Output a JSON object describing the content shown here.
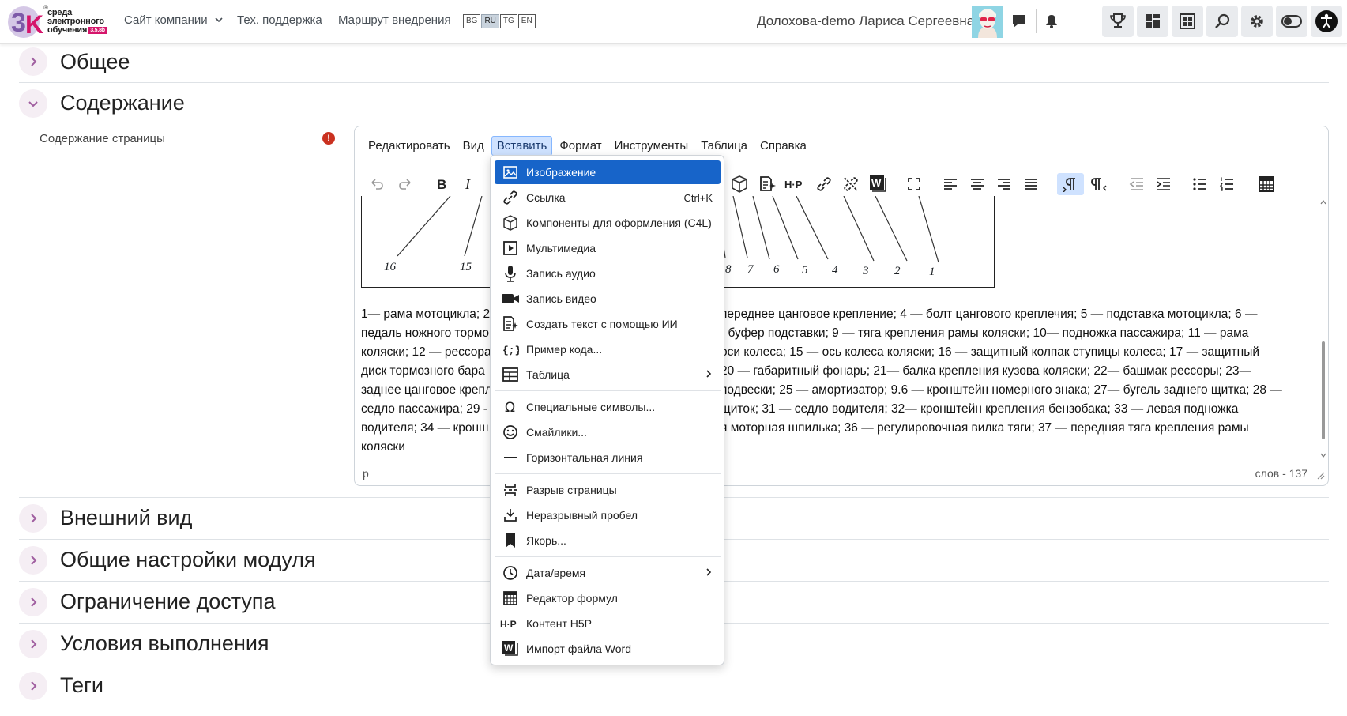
{
  "navbar": {
    "logo_lines": [
      "среда",
      "электронного",
      "обучения"
    ],
    "logo_badge": "3.5.8b",
    "links": [
      "Сайт компании",
      "Тех. поддержка",
      "Маршрут внедрения"
    ],
    "languages": [
      "BG",
      "RU",
      "TG",
      "EN"
    ],
    "active_language": "RU",
    "username": "Долохова-demo Лариса Сергеевна"
  },
  "sections": [
    {
      "title": "Общее",
      "expanded": false
    },
    {
      "title": "Содержание",
      "expanded": true
    },
    {
      "title": "Внешний вид",
      "expanded": false
    },
    {
      "title": "Общие настройки модуля",
      "expanded": false
    },
    {
      "title": "Ограничение доступа",
      "expanded": false
    },
    {
      "title": "Условия выполнения",
      "expanded": false
    },
    {
      "title": "Теги",
      "expanded": false
    }
  ],
  "field": {
    "label": "Содержание страницы",
    "required_icon": "!"
  },
  "editor": {
    "menubar": [
      "Редактировать",
      "Вид",
      "Вставить",
      "Формат",
      "Инструменты",
      "Таблица",
      "Справка"
    ],
    "active_menu": "Вставить",
    "figure_numbers": [
      "16",
      "15",
      "8",
      "7",
      "6",
      "5",
      "4",
      "3",
      "2",
      "1"
    ],
    "paragraph_lines": [
      "1— рама мотоцикла; 2",
      "переднее цанговое крепление; 4 — болт цангового креплечия; 5 — подставка мотоцикла; 6 —",
      "педаль ножного тормо",
      "- буфер подставки; 9 — тяга крепления рамы коляски; 10— подножка пассажира; 11 — рама",
      "коляски; 12 — рессора",
      "оси колеса; 15 — ось колеса коляски; 16 — защитный колпак ступицы колеса; 17 — защитный",
      "диск тормозного бара",
      "20 — габаритный фонарь; 21— балка крепления кузова коляски; 22— башмак рессоры; 23—",
      "заднее цанговое крепл",
      "подвески; 25 — амортизатор; 9.6 — кронштейн номерного знака; 27— бугель заднего щитка; 28 —",
      "седло пассажира; 29 -",
      "щиток; 31 — седло водителя; 32— кронштейн крепления бензобака; 33 — левая подножка",
      "водителя; 34 — кронш",
      "я моторная шпилька; 36 — регулировочная вилка тяги; 37 — передняя тяга крепления рамы",
      "коляски"
    ],
    "status_path": "p",
    "word_count": "слов - 137"
  },
  "insert_menu": [
    {
      "label": "Изображение",
      "icon": "image-icon",
      "highlighted": true
    },
    {
      "label": "Ссылка",
      "icon": "link-icon",
      "shortcut": "Ctrl+K"
    },
    {
      "label": "Компоненты для оформления (C4L)",
      "icon": "cube-icon"
    },
    {
      "label": "Мультимедиа",
      "icon": "media-icon"
    },
    {
      "label": "Запись аудио",
      "icon": "microphone-icon"
    },
    {
      "label": "Запись видео",
      "icon": "video-camera-icon"
    },
    {
      "label": "Создать текст с помощью ИИ",
      "icon": "ai-text-icon"
    },
    {
      "label": "Пример кода...",
      "icon": "code-sample-icon"
    },
    {
      "label": "Таблица",
      "icon": "table-icon",
      "submenu": true
    },
    {
      "label": "Специальные символы...",
      "icon": "omega-icon"
    },
    {
      "label": "Смайлики...",
      "icon": "emoji-icon"
    },
    {
      "label": "Горизонтальная линия",
      "icon": "horizontal-line-icon"
    },
    {
      "label": "Разрыв страницы",
      "icon": "page-break-icon"
    },
    {
      "label": "Неразрывный пробел",
      "icon": "nbsp-icon"
    },
    {
      "label": "Якорь...",
      "icon": "bookmark-icon"
    },
    {
      "label": "Дата/время",
      "icon": "clock-icon",
      "submenu": true
    },
    {
      "label": "Редактор формул",
      "icon": "calculator-icon"
    },
    {
      "label": "Контент H5P",
      "icon": "h5p-icon"
    },
    {
      "label": "Импорт файла Word",
      "icon": "word-icon"
    }
  ],
  "colors": {
    "accent": "#1764c9",
    "chevron_bg": "#f5eef4",
    "chevron": "#a05ea0",
    "required": "#ca3120",
    "brand": "#d5156b"
  }
}
